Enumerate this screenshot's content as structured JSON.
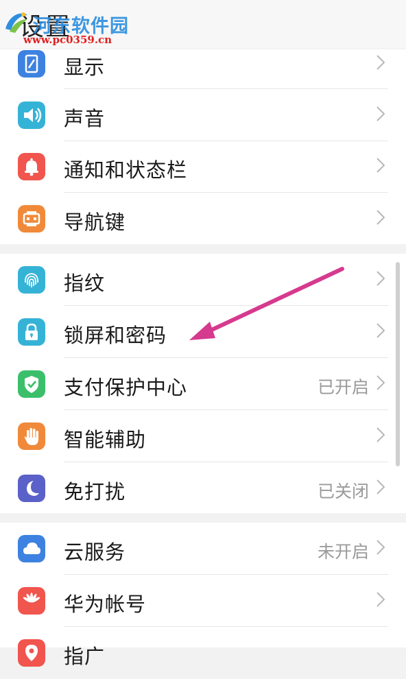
{
  "header": {
    "title": "设置"
  },
  "watermark": {
    "name": "河东软件园",
    "url": "www.pc0359.cn"
  },
  "groups": [
    {
      "items": [
        {
          "label": "显示",
          "status": "",
          "icon": "display-icon",
          "color": "#3d82e0"
        },
        {
          "label": "声音",
          "status": "",
          "icon": "speaker-icon",
          "color": "#35b3d6"
        },
        {
          "label": "通知和状态栏",
          "status": "",
          "icon": "bell-icon",
          "color": "#f0554e"
        },
        {
          "label": "导航键",
          "status": "",
          "icon": "navigation-key-icon",
          "color": "#f08a3a"
        }
      ]
    },
    {
      "items": [
        {
          "label": "指纹",
          "status": "",
          "icon": "fingerprint-icon",
          "color": "#35b3d6"
        },
        {
          "label": "锁屏和密码",
          "status": "",
          "icon": "lock-icon",
          "color": "#35b3d6"
        },
        {
          "label": "支付保护中心",
          "status": "已开启",
          "icon": "shield-check-icon",
          "color": "#3cbf6a"
        },
        {
          "label": "智能辅助",
          "status": "",
          "icon": "hand-icon",
          "color": "#f08a3a"
        },
        {
          "label": "免打扰",
          "status": "已关闭",
          "icon": "moon-icon",
          "color": "#5a61c8"
        }
      ]
    },
    {
      "items": [
        {
          "label": "云服务",
          "status": "未开启",
          "icon": "cloud-icon",
          "color": "#3d82e0"
        },
        {
          "label": "华为帐号",
          "status": "",
          "icon": "huawei-logo-icon",
          "color": "#f0554e"
        },
        {
          "label": "指广",
          "status": "",
          "icon": "location-icon",
          "color": "#f0554e"
        }
      ]
    }
  ],
  "annotation": {
    "arrow_color": "#d63a8f"
  }
}
